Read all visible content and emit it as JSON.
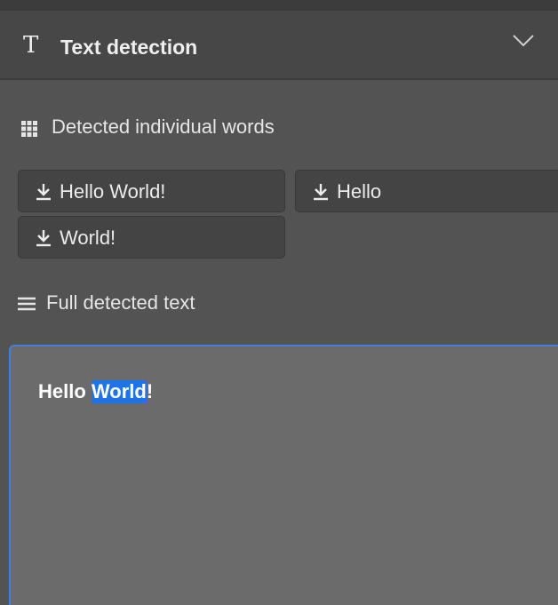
{
  "panel": {
    "title": "Text detection",
    "t_icon_glyph": "T",
    "chevron_icon": "chevron-down-icon"
  },
  "words_section": {
    "label": "Detected individual words",
    "icon": "grid-icon",
    "buttons": [
      {
        "label": "Hello World!",
        "icon": "download-icon"
      },
      {
        "label": "Hello",
        "icon": "download-icon"
      },
      {
        "label": "World!",
        "icon": "download-icon"
      }
    ]
  },
  "full_text_section": {
    "label": "Full detected text",
    "icon": "menu-lines-icon",
    "text_before": "Hello ",
    "text_selected": "World",
    "text_after": "!"
  },
  "colors": {
    "panel_bg": "#535353",
    "header_bg": "#474747",
    "button_bg": "#444444",
    "textarea_bg": "#6b6b6b",
    "focus_border": "#3d7fe0",
    "selection": "#1f73e6"
  }
}
